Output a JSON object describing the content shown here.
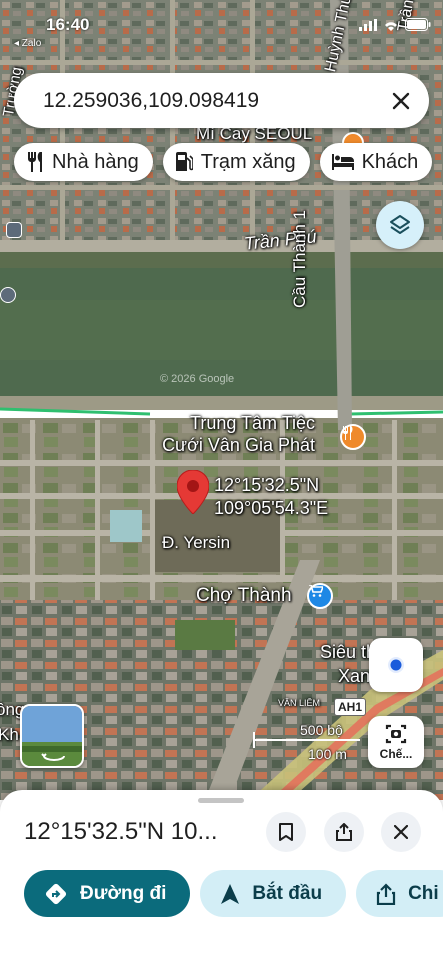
{
  "status_bar": {
    "time": "16:40",
    "back_app": "◂ Zalo"
  },
  "search": {
    "query": "12.259036,109.098419"
  },
  "chips": [
    {
      "label": "Nhà hàng",
      "icon": "fork-knife-icon"
    },
    {
      "label": "Trạm xăng",
      "icon": "gas-station-icon"
    },
    {
      "label": "Khách",
      "icon": "bed-icon"
    }
  ],
  "map": {
    "street_tran_phu": "Trần Phú",
    "bridge": "Cầu Thành 1",
    "place_top": "Mì Cay SEOUL",
    "venue_line1": "Trung Tâm Tiệc",
    "venue_line2": "Cưới Vân Gia Phát",
    "pin_lat": "12°15'32.5\"N",
    "pin_lon": "109°05'54.3\"E",
    "street_yersin": "Đ. Yersin",
    "market": "Chợ Thành",
    "supermarket_line1": "Siêu thị Điện",
    "supermarket_line2": "Xanh Kh",
    "left_label_1": "ông",
    "left_label_2": "Kh",
    "top_left_vertical": "Trường",
    "top_right_vertical_1": "Huỳnh Thúc Kháng",
    "top_right_vertical_2": "Trần",
    "highway": "AH1",
    "copyright": "© 2026 Google",
    "van_liem": "VĂN LIÊM",
    "scale_imperial": "500 bộ",
    "scale_metric": "100 m",
    "river_color": "#4f6a4e",
    "pin_color": "#e53935"
  },
  "lens": {
    "label": "Chế..."
  },
  "sheet": {
    "title": "12°15'32.5\"N 10...",
    "actions": [
      {
        "label": "Đường đi",
        "icon": "directions-icon"
      },
      {
        "label": "Bắt đầu",
        "icon": "navigation-arrow-icon"
      },
      {
        "label": "Chi",
        "icon": "share-icon"
      }
    ]
  }
}
